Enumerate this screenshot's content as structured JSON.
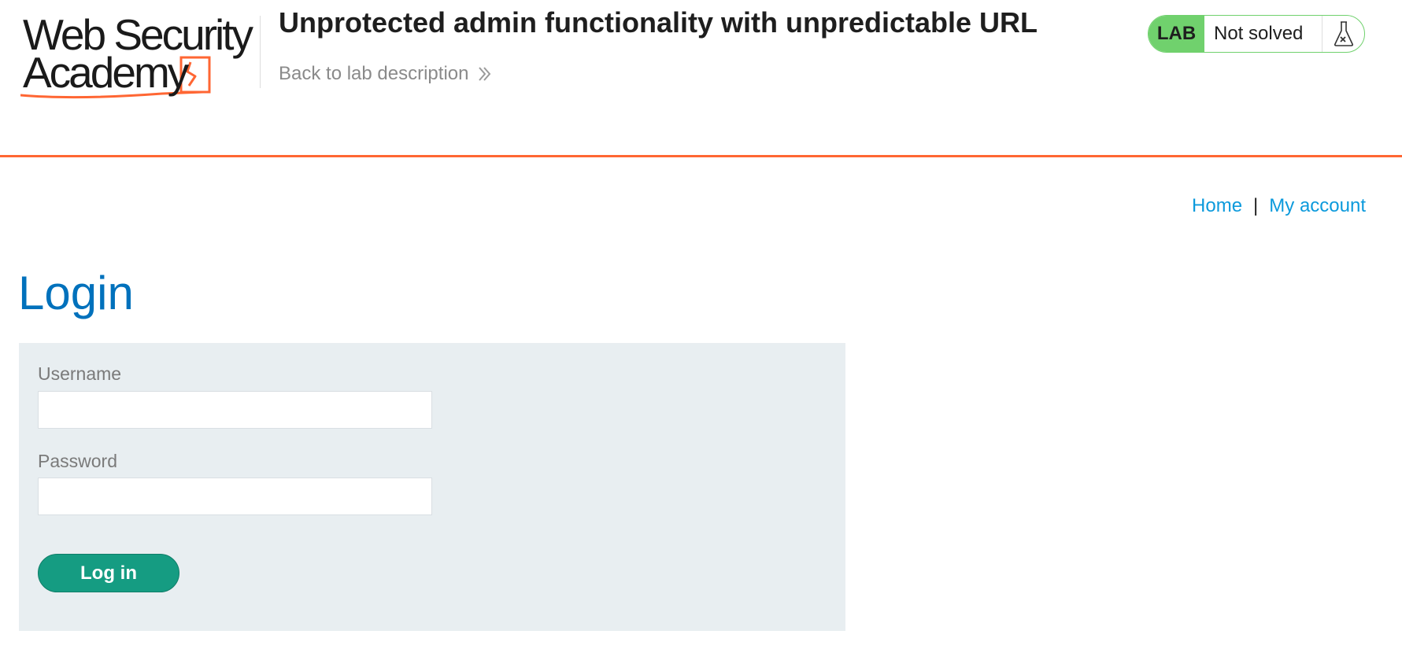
{
  "header": {
    "logo_line1": "Web Security",
    "logo_line2": "Academy",
    "lab_title": "Unprotected admin functionality with unpredictable URL",
    "back_link": "Back to lab description",
    "status_badge": "LAB",
    "status_text": "Not solved",
    "accent_color": "#ff6633",
    "status_color": "#70d16d"
  },
  "nav": {
    "home": "Home",
    "separator": "|",
    "my_account": "My account"
  },
  "login": {
    "title": "Login",
    "username_label": "Username",
    "username_value": "",
    "password_label": "Password",
    "password_value": "",
    "submit_label": "Log in",
    "button_color": "#159c82"
  },
  "icons": {
    "back_link_icon": "double-chevron-right-icon",
    "status_icon": "flask-icon"
  }
}
